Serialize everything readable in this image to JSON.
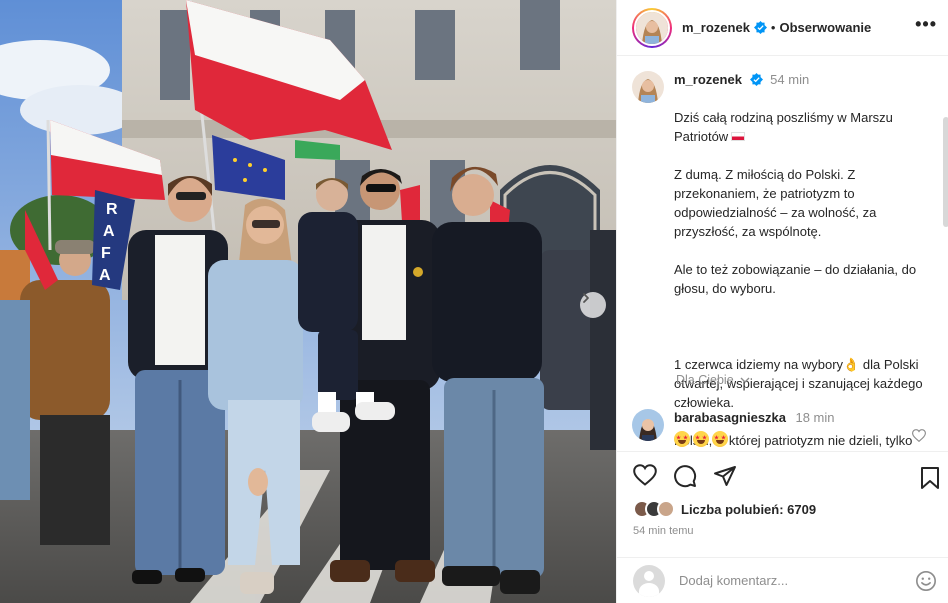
{
  "post": {
    "username": "m_rozenek",
    "follow_label": "Obserwowanie",
    "more_label": "•••",
    "caption_time": "54 min",
    "caption_lines": [
      "Dziś całą rodziną poszliśmy w Marszu Patriotów",
      "Z dumą. Z miłością do Polski. Z przekonaniem, że patriotyzm to odpowiedzialność – za wolność, za przyszłość, za wspólnotę.",
      "Ale to też zobowiązanie – do działania, do głosu, do wyboru.",
      "",
      "1 czerwca idziemy na wybory👌 dla Polski otwartej, wspierającej i szanującej każdego człowieka.",
      "Polski, w której patriotyzm nie dzieli, tylko łączy"
    ],
    "translate_label": "Dla Ciebie",
    "likes_prefix": "Liczba polubień: ",
    "likes_count": "6709",
    "post_time": "54 min temu",
    "comment_placeholder": "Dodaj komentarz..."
  },
  "comment": {
    "username": "barabasagnieszka",
    "time": "18 min",
    "emojis": [
      "star-struck",
      "star-struck",
      "star-struck"
    ]
  },
  "icons": {
    "verified": "verified-badge-icon",
    "like": "heart-icon",
    "comment": "comment-icon",
    "share": "share-icon",
    "save": "bookmark-icon",
    "emoji": "smiley-icon",
    "next": "chevron-right-icon"
  },
  "photo": {
    "banner_letters": [
      "R",
      "A",
      "F",
      "A"
    ]
  },
  "colors": {
    "verified_blue": "#0095f6",
    "flag_red": "#dc143c",
    "text": "#262626",
    "muted": "#8e8e8e"
  }
}
